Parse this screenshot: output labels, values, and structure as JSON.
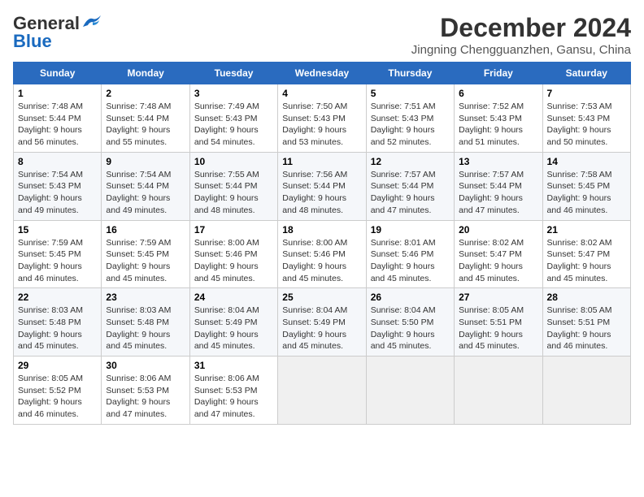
{
  "logo": {
    "general": "General",
    "blue": "Blue"
  },
  "title": "December 2024",
  "subtitle": "Jingning Chengguanzhen, Gansu, China",
  "days_of_week": [
    "Sunday",
    "Monday",
    "Tuesday",
    "Wednesday",
    "Thursday",
    "Friday",
    "Saturday"
  ],
  "weeks": [
    [
      {
        "day": "1",
        "sunrise": "Sunrise: 7:48 AM",
        "sunset": "Sunset: 5:44 PM",
        "daylight": "Daylight: 9 hours and 56 minutes."
      },
      {
        "day": "2",
        "sunrise": "Sunrise: 7:48 AM",
        "sunset": "Sunset: 5:44 PM",
        "daylight": "Daylight: 9 hours and 55 minutes."
      },
      {
        "day": "3",
        "sunrise": "Sunrise: 7:49 AM",
        "sunset": "Sunset: 5:43 PM",
        "daylight": "Daylight: 9 hours and 54 minutes."
      },
      {
        "day": "4",
        "sunrise": "Sunrise: 7:50 AM",
        "sunset": "Sunset: 5:43 PM",
        "daylight": "Daylight: 9 hours and 53 minutes."
      },
      {
        "day": "5",
        "sunrise": "Sunrise: 7:51 AM",
        "sunset": "Sunset: 5:43 PM",
        "daylight": "Daylight: 9 hours and 52 minutes."
      },
      {
        "day": "6",
        "sunrise": "Sunrise: 7:52 AM",
        "sunset": "Sunset: 5:43 PM",
        "daylight": "Daylight: 9 hours and 51 minutes."
      },
      {
        "day": "7",
        "sunrise": "Sunrise: 7:53 AM",
        "sunset": "Sunset: 5:43 PM",
        "daylight": "Daylight: 9 hours and 50 minutes."
      }
    ],
    [
      {
        "day": "8",
        "sunrise": "Sunrise: 7:54 AM",
        "sunset": "Sunset: 5:43 PM",
        "daylight": "Daylight: 9 hours and 49 minutes."
      },
      {
        "day": "9",
        "sunrise": "Sunrise: 7:54 AM",
        "sunset": "Sunset: 5:44 PM",
        "daylight": "Daylight: 9 hours and 49 minutes."
      },
      {
        "day": "10",
        "sunrise": "Sunrise: 7:55 AM",
        "sunset": "Sunset: 5:44 PM",
        "daylight": "Daylight: 9 hours and 48 minutes."
      },
      {
        "day": "11",
        "sunrise": "Sunrise: 7:56 AM",
        "sunset": "Sunset: 5:44 PM",
        "daylight": "Daylight: 9 hours and 48 minutes."
      },
      {
        "day": "12",
        "sunrise": "Sunrise: 7:57 AM",
        "sunset": "Sunset: 5:44 PM",
        "daylight": "Daylight: 9 hours and 47 minutes."
      },
      {
        "day": "13",
        "sunrise": "Sunrise: 7:57 AM",
        "sunset": "Sunset: 5:44 PM",
        "daylight": "Daylight: 9 hours and 47 minutes."
      },
      {
        "day": "14",
        "sunrise": "Sunrise: 7:58 AM",
        "sunset": "Sunset: 5:45 PM",
        "daylight": "Daylight: 9 hours and 46 minutes."
      }
    ],
    [
      {
        "day": "15",
        "sunrise": "Sunrise: 7:59 AM",
        "sunset": "Sunset: 5:45 PM",
        "daylight": "Daylight: 9 hours and 46 minutes."
      },
      {
        "day": "16",
        "sunrise": "Sunrise: 7:59 AM",
        "sunset": "Sunset: 5:45 PM",
        "daylight": "Daylight: 9 hours and 45 minutes."
      },
      {
        "day": "17",
        "sunrise": "Sunrise: 8:00 AM",
        "sunset": "Sunset: 5:46 PM",
        "daylight": "Daylight: 9 hours and 45 minutes."
      },
      {
        "day": "18",
        "sunrise": "Sunrise: 8:00 AM",
        "sunset": "Sunset: 5:46 PM",
        "daylight": "Daylight: 9 hours and 45 minutes."
      },
      {
        "day": "19",
        "sunrise": "Sunrise: 8:01 AM",
        "sunset": "Sunset: 5:46 PM",
        "daylight": "Daylight: 9 hours and 45 minutes."
      },
      {
        "day": "20",
        "sunrise": "Sunrise: 8:02 AM",
        "sunset": "Sunset: 5:47 PM",
        "daylight": "Daylight: 9 hours and 45 minutes."
      },
      {
        "day": "21",
        "sunrise": "Sunrise: 8:02 AM",
        "sunset": "Sunset: 5:47 PM",
        "daylight": "Daylight: 9 hours and 45 minutes."
      }
    ],
    [
      {
        "day": "22",
        "sunrise": "Sunrise: 8:03 AM",
        "sunset": "Sunset: 5:48 PM",
        "daylight": "Daylight: 9 hours and 45 minutes."
      },
      {
        "day": "23",
        "sunrise": "Sunrise: 8:03 AM",
        "sunset": "Sunset: 5:48 PM",
        "daylight": "Daylight: 9 hours and 45 minutes."
      },
      {
        "day": "24",
        "sunrise": "Sunrise: 8:04 AM",
        "sunset": "Sunset: 5:49 PM",
        "daylight": "Daylight: 9 hours and 45 minutes."
      },
      {
        "day": "25",
        "sunrise": "Sunrise: 8:04 AM",
        "sunset": "Sunset: 5:49 PM",
        "daylight": "Daylight: 9 hours and 45 minutes."
      },
      {
        "day": "26",
        "sunrise": "Sunrise: 8:04 AM",
        "sunset": "Sunset: 5:50 PM",
        "daylight": "Daylight: 9 hours and 45 minutes."
      },
      {
        "day": "27",
        "sunrise": "Sunrise: 8:05 AM",
        "sunset": "Sunset: 5:51 PM",
        "daylight": "Daylight: 9 hours and 45 minutes."
      },
      {
        "day": "28",
        "sunrise": "Sunrise: 8:05 AM",
        "sunset": "Sunset: 5:51 PM",
        "daylight": "Daylight: 9 hours and 46 minutes."
      }
    ],
    [
      {
        "day": "29",
        "sunrise": "Sunrise: 8:05 AM",
        "sunset": "Sunset: 5:52 PM",
        "daylight": "Daylight: 9 hours and 46 minutes."
      },
      {
        "day": "30",
        "sunrise": "Sunrise: 8:06 AM",
        "sunset": "Sunset: 5:53 PM",
        "daylight": "Daylight: 9 hours and 47 minutes."
      },
      {
        "day": "31",
        "sunrise": "Sunrise: 8:06 AM",
        "sunset": "Sunset: 5:53 PM",
        "daylight": "Daylight: 9 hours and 47 minutes."
      },
      null,
      null,
      null,
      null
    ]
  ]
}
